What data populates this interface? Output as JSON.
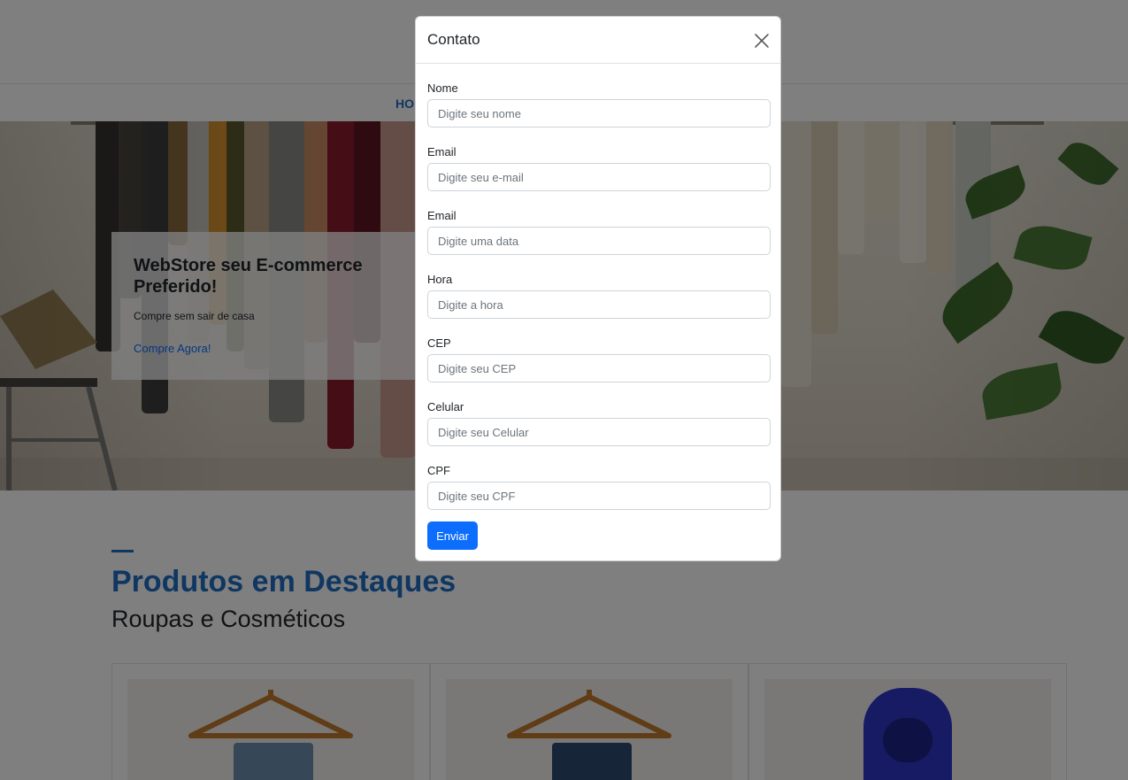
{
  "nav": {
    "home_fragment": "HO",
    "trailing_fragment": ":"
  },
  "hero": {
    "title": "WebStore seu E-commerce Preferido!",
    "subtitle": "Compre sem sair de casa",
    "cta": "Compre Agora!"
  },
  "section": {
    "title": "Produtos em Destaques",
    "subtitle": "Roupas e Cosméticos"
  },
  "products": [
    {
      "image_icon": "jeans-on-hanger"
    },
    {
      "image_icon": "jeans-on-hanger"
    },
    {
      "image_icon": "blue-hooded-jacket"
    }
  ],
  "modal": {
    "title": "Contato",
    "close_icon": "close-icon",
    "fields": [
      {
        "label": "Nome",
        "placeholder": "Digite seu nome",
        "value": ""
      },
      {
        "label": "Email",
        "placeholder": "Digite seu e-mail",
        "value": ""
      },
      {
        "label": "Email",
        "placeholder": "Digite uma data",
        "value": ""
      },
      {
        "label": "Hora",
        "placeholder": "Digite a hora",
        "value": ""
      },
      {
        "label": "CEP",
        "placeholder": "Digite seu CEP",
        "value": ""
      },
      {
        "label": "Celular",
        "placeholder": "Digite seu Celular",
        "value": ""
      },
      {
        "label": "CPF",
        "placeholder": "Digite seu CPF",
        "value": ""
      }
    ],
    "submit_label": "Enviar"
  },
  "colors": {
    "accent": "#1f6fc5",
    "primary_button": "#0d6efd",
    "backdrop": "rgba(0,0,0,0.5)"
  }
}
